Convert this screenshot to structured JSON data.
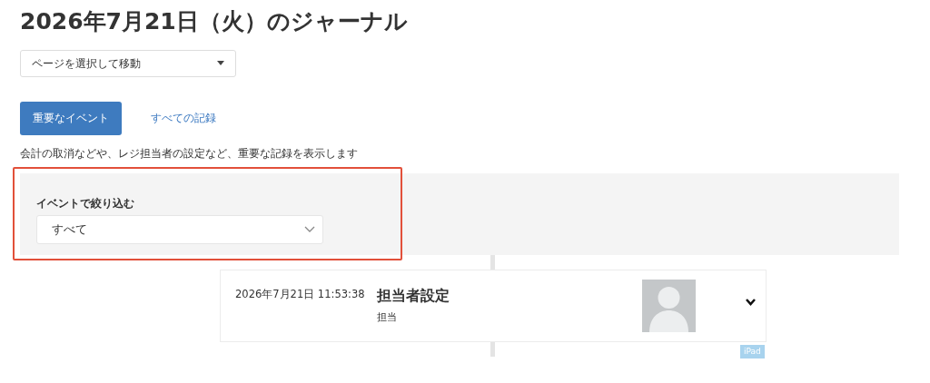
{
  "page_title": "2026年7月21日（火）のジャーナル",
  "page_select": {
    "value": "ページを選択して移動"
  },
  "tabs": [
    {
      "label": "重要なイベント",
      "selected": true
    },
    {
      "label": "すべての記録",
      "selected": false
    }
  ],
  "description": "会計の取消などや、レジ担当者の設定など、重要な記録を表示します",
  "filter": {
    "label": "イベントで絞り込む",
    "value": "すべて",
    "highlighted": true
  },
  "entries": [
    {
      "timestamp": "2026年7月21日 11:53:38",
      "title": "担当者設定",
      "subtitle": "担当",
      "expanded": false,
      "device": "iPad"
    }
  ]
}
